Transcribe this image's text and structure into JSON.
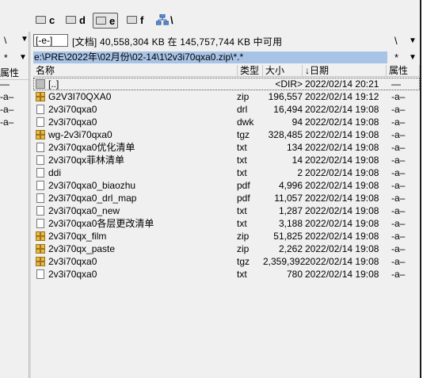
{
  "drives": [
    {
      "letter": "c",
      "active": false
    },
    {
      "letter": "d",
      "active": false
    },
    {
      "letter": "e",
      "active": true
    },
    {
      "letter": "f",
      "active": false
    }
  ],
  "network_label": "\\",
  "left_panel": {
    "nav_back": "\\",
    "nav_star": "*",
    "nav_arrow": "▼",
    "header_attr": "属性",
    "attrs": [
      "—",
      "-a–",
      "-a–",
      "-a–"
    ]
  },
  "right_panel": {
    "drive_selector": "[-e-]",
    "drive_info": "[文档]  40,558,304 KB 在 145,757,744 KB 中可用",
    "nav_back": "\\",
    "nav_arrow": "▼",
    "nav_star": "*",
    "path": "e:\\PRE\\2022年\\02月份\\02-14\\1\\2v3i70qxa0.zip\\*.*",
    "columns": {
      "name": "名称",
      "ext": "类型",
      "size": "大小",
      "date": "↓日期",
      "attr": "属性"
    },
    "files": [
      {
        "name": "[..]",
        "ext": "",
        "size": "<DIR>",
        "date": "2022/02/14 20:21",
        "attr": "—",
        "icon": "up"
      },
      {
        "name": "G2V3I70QXA0",
        "ext": "zip",
        "size": "196,557",
        "date": "2022/02/14 19:12",
        "attr": "-a–",
        "icon": "zip"
      },
      {
        "name": "2v3i70qxa0",
        "ext": "drl",
        "size": "16,494",
        "date": "2022/02/14 19:08",
        "attr": "-a–",
        "icon": "doc"
      },
      {
        "name": "2v3i70qxa0",
        "ext": "dwk",
        "size": "94",
        "date": "2022/02/14 19:08",
        "attr": "-a–",
        "icon": "doc"
      },
      {
        "name": "wg-2v3i70qxa0",
        "ext": "tgz",
        "size": "328,485",
        "date": "2022/02/14 19:08",
        "attr": "-a–",
        "icon": "zip"
      },
      {
        "name": "2v3i70qxa0优化清单",
        "ext": "txt",
        "size": "134",
        "date": "2022/02/14 19:08",
        "attr": "-a–",
        "icon": "doc"
      },
      {
        "name": "2v3i70qx菲林清单",
        "ext": "txt",
        "size": "14",
        "date": "2022/02/14 19:08",
        "attr": "-a–",
        "icon": "doc"
      },
      {
        "name": "ddi",
        "ext": "txt",
        "size": "2",
        "date": "2022/02/14 19:08",
        "attr": "-a–",
        "icon": "doc"
      },
      {
        "name": "2v3i70qxa0_biaozhu",
        "ext": "pdf",
        "size": "4,996",
        "date": "2022/02/14 19:08",
        "attr": "-a–",
        "icon": "doc"
      },
      {
        "name": "2v3i70qxa0_drl_map",
        "ext": "pdf",
        "size": "11,057",
        "date": "2022/02/14 19:08",
        "attr": "-a–",
        "icon": "doc"
      },
      {
        "name": "2v3i70qxa0_new",
        "ext": "txt",
        "size": "1,287",
        "date": "2022/02/14 19:08",
        "attr": "-a–",
        "icon": "doc"
      },
      {
        "name": "2v3i70qxa0各层更改清单",
        "ext": "txt",
        "size": "3,188",
        "date": "2022/02/14 19:08",
        "attr": "-a–",
        "icon": "doc"
      },
      {
        "name": "2v3i70qx_film",
        "ext": "zip",
        "size": "51,825",
        "date": "2022/02/14 19:08",
        "attr": "-a–",
        "icon": "zip"
      },
      {
        "name": "2v3i70qx_paste",
        "ext": "zip",
        "size": "2,262",
        "date": "2022/02/14 19:08",
        "attr": "-a–",
        "icon": "zip"
      },
      {
        "name": "2v3i70qxa0",
        "ext": "tgz",
        "size": "2,359,392",
        "date": "2022/02/14 19:08",
        "attr": "-a–",
        "icon": "zip"
      },
      {
        "name": "2v3i70qxa0",
        "ext": "txt",
        "size": "780",
        "date": "2022/02/14 19:08",
        "attr": "-a–",
        "icon": "doc"
      }
    ]
  }
}
